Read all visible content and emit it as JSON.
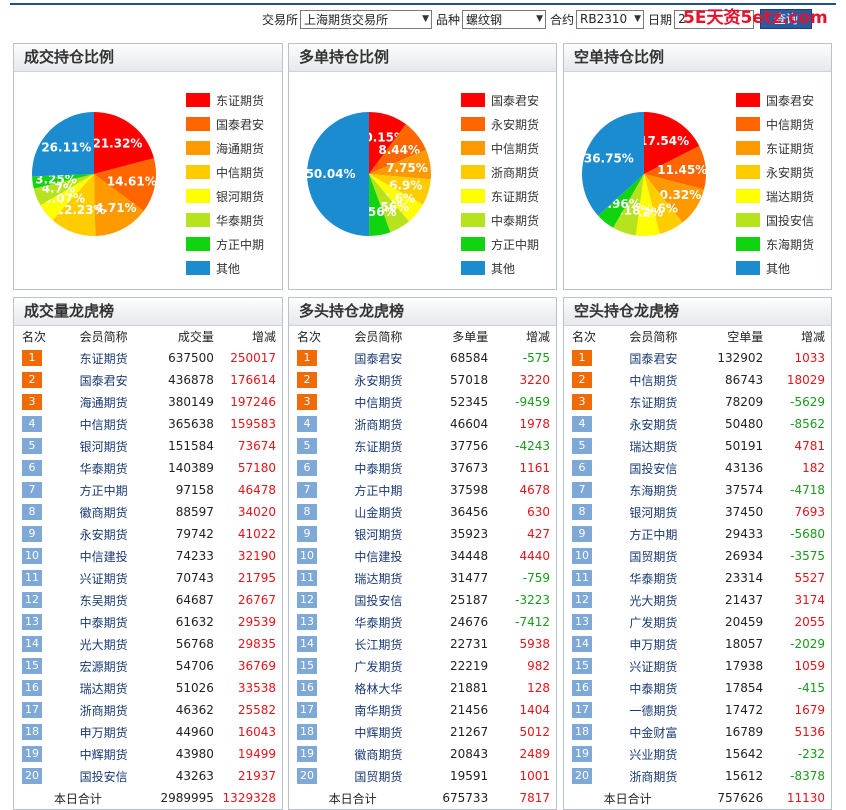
{
  "toolbar": {
    "exchange_label": "交易所",
    "exchange_value": "上海期货交易所",
    "product_label": "品种",
    "product_value": "螺纹钢",
    "contract_label": "合约",
    "contract_value": "RB2310",
    "date_label": "日期",
    "date_value": "2",
    "query_label": "查询"
  },
  "watermark": "5E天资5etz.com",
  "pie_panels": [
    {
      "title": "成交持仓比例",
      "chart_data": {
        "type": "pie",
        "slices": [
          {
            "name": "东证期货",
            "value": 21.32,
            "label": "21.32%",
            "color": "#ff0000"
          },
          {
            "name": "国泰君安",
            "value": 14.61,
            "label": "14.61%",
            "color": "#ff6600"
          },
          {
            "name": "海通期货",
            "value": 14.71,
            "label": "14.71%",
            "color": "#ff9900"
          },
          {
            "name": "中信期货",
            "value": 12.23,
            "label": "12.23%",
            "color": "#ffcc00"
          },
          {
            "name": "银河期货",
            "value": 5.07,
            "label": "5.07%",
            "color": "#ffff00"
          },
          {
            "name": "华泰期货",
            "value": 4.7,
            "label": "4.7%",
            "color": "#b6e21e"
          },
          {
            "name": "方正中期",
            "value": 3.25,
            "label": "3.25%",
            "color": "#10d410"
          },
          {
            "name": "其他",
            "value": 26.11,
            "label": "26.11%",
            "color": "#1a8ccf"
          }
        ]
      }
    },
    {
      "title": "多单持仓比例",
      "chart_data": {
        "type": "pie",
        "slices": [
          {
            "name": "国泰君安",
            "value": 10.15,
            "label": "10.15%",
            "color": "#ff0000"
          },
          {
            "name": "永安期货",
            "value": 8.44,
            "label": "8.44%",
            "color": "#ff6600"
          },
          {
            "name": "中信期货",
            "value": 7.75,
            "label": "7.75%",
            "color": "#ff9900"
          },
          {
            "name": "浙商期货",
            "value": 6.9,
            "label": "6.9%",
            "color": "#ffcc00"
          },
          {
            "name": "东证期货",
            "value": 5.6,
            "label": "5.6%",
            "color": "#ffff00"
          },
          {
            "name": "中泰期货",
            "value": 5.56,
            "label": "5.56%",
            "color": "#b6e21e"
          },
          {
            "name": "方正中期",
            "value": 5.56,
            "label": "5.56%",
            "color": "#10d410"
          },
          {
            "name": "其他",
            "value": 50.04,
            "label": "50.04%",
            "color": "#1a8ccf"
          }
        ]
      }
    },
    {
      "title": "空单持仓比例",
      "chart_data": {
        "type": "pie",
        "slices": [
          {
            "name": "国泰君安",
            "value": 17.54,
            "label": "17.54%",
            "color": "#ff0000"
          },
          {
            "name": "中信期货",
            "value": 11.45,
            "label": "11.45%",
            "color": "#ff6600"
          },
          {
            "name": "东证期货",
            "value": 10.32,
            "label": "10.32%",
            "color": "#ff9900"
          },
          {
            "name": "永安期货",
            "value": 6.6,
            "label": "6.6%",
            "color": "#ffcc00"
          },
          {
            "name": "瑞达期货",
            "value": 6.2,
            "label": "6.2%",
            "color": "#ffff00"
          },
          {
            "name": "国投安信",
            "value": 6.18,
            "label": "6.18%",
            "color": "#b6e21e"
          },
          {
            "name": "东海期货",
            "value": 4.96,
            "label": "4.96%",
            "color": "#10d410"
          },
          {
            "name": "其他",
            "value": 36.75,
            "label": "36.75%",
            "color": "#1a8ccf"
          }
        ]
      }
    }
  ],
  "rank_panels": [
    {
      "title": "成交量龙虎榜",
      "headers": [
        "名次",
        "会员简称",
        "成交量",
        "增减"
      ],
      "rows": [
        [
          "1",
          "东证期货",
          "637500",
          "250017"
        ],
        [
          "2",
          "国泰君安",
          "436878",
          "176614"
        ],
        [
          "3",
          "海通期货",
          "380149",
          "197246"
        ],
        [
          "4",
          "中信期货",
          "365638",
          "159583"
        ],
        [
          "5",
          "银河期货",
          "151584",
          "73674"
        ],
        [
          "6",
          "华泰期货",
          "140389",
          "57180"
        ],
        [
          "7",
          "方正中期",
          "97158",
          "46478"
        ],
        [
          "8",
          "徽商期货",
          "88597",
          "34020"
        ],
        [
          "9",
          "永安期货",
          "79742",
          "41022"
        ],
        [
          "10",
          "中信建投",
          "74233",
          "32190"
        ],
        [
          "11",
          "兴证期货",
          "70743",
          "21795"
        ],
        [
          "12",
          "东吴期货",
          "64687",
          "26767"
        ],
        [
          "13",
          "中泰期货",
          "61632",
          "29539"
        ],
        [
          "14",
          "光大期货",
          "56768",
          "29835"
        ],
        [
          "15",
          "宏源期货",
          "54706",
          "36769"
        ],
        [
          "16",
          "瑞达期货",
          "51026",
          "33538"
        ],
        [
          "17",
          "浙商期货",
          "46362",
          "25582"
        ],
        [
          "18",
          "申万期货",
          "44960",
          "16043"
        ],
        [
          "19",
          "中辉期货",
          "43980",
          "19499"
        ],
        [
          "20",
          "国投安信",
          "43263",
          "21937"
        ]
      ],
      "total_label": "本日合计",
      "total_value": "2989995",
      "total_change": "1329328"
    },
    {
      "title": "多头持仓龙虎榜",
      "headers": [
        "名次",
        "会员简称",
        "多单量",
        "增减"
      ],
      "rows": [
        [
          "1",
          "国泰君安",
          "68584",
          "-575"
        ],
        [
          "2",
          "永安期货",
          "57018",
          "3220"
        ],
        [
          "3",
          "中信期货",
          "52345",
          "-9459"
        ],
        [
          "4",
          "浙商期货",
          "46604",
          "1978"
        ],
        [
          "5",
          "东证期货",
          "37756",
          "-4243"
        ],
        [
          "6",
          "中泰期货",
          "37673",
          "1161"
        ],
        [
          "7",
          "方正中期",
          "37598",
          "4678"
        ],
        [
          "8",
          "山金期货",
          "36456",
          "630"
        ],
        [
          "9",
          "银河期货",
          "35923",
          "427"
        ],
        [
          "10",
          "中信建投",
          "34448",
          "4440"
        ],
        [
          "11",
          "瑞达期货",
          "31477",
          "-759"
        ],
        [
          "12",
          "国投安信",
          "25187",
          "-3223"
        ],
        [
          "13",
          "华泰期货",
          "24676",
          "-7412"
        ],
        [
          "14",
          "长江期货",
          "22731",
          "5938"
        ],
        [
          "15",
          "广发期货",
          "22219",
          "982"
        ],
        [
          "16",
          "格林大华",
          "21881",
          "128"
        ],
        [
          "17",
          "南华期货",
          "21456",
          "1404"
        ],
        [
          "18",
          "中辉期货",
          "21267",
          "5012"
        ],
        [
          "19",
          "徽商期货",
          "20843",
          "2489"
        ],
        [
          "20",
          "国贸期货",
          "19591",
          "1001"
        ]
      ],
      "total_label": "本日合计",
      "total_value": "675733",
      "total_change": "7817"
    },
    {
      "title": "空头持仓龙虎榜",
      "headers": [
        "名次",
        "会员简称",
        "空单量",
        "增减"
      ],
      "rows": [
        [
          "1",
          "国泰君安",
          "132902",
          "1033"
        ],
        [
          "2",
          "中信期货",
          "86743",
          "18029"
        ],
        [
          "3",
          "东证期货",
          "78209",
          "-5629"
        ],
        [
          "4",
          "永安期货",
          "50480",
          "-8562"
        ],
        [
          "5",
          "瑞达期货",
          "50191",
          "4781"
        ],
        [
          "6",
          "国投安信",
          "43136",
          "182"
        ],
        [
          "7",
          "东海期货",
          "37574",
          "-4718"
        ],
        [
          "8",
          "银河期货",
          "37450",
          "7693"
        ],
        [
          "9",
          "方正中期",
          "29433",
          "-5680"
        ],
        [
          "10",
          "国贸期货",
          "26934",
          "-3575"
        ],
        [
          "11",
          "华泰期货",
          "23314",
          "5527"
        ],
        [
          "12",
          "光大期货",
          "21437",
          "3174"
        ],
        [
          "13",
          "广发期货",
          "20459",
          "2055"
        ],
        [
          "14",
          "申万期货",
          "18057",
          "-2029"
        ],
        [
          "15",
          "兴证期货",
          "17938",
          "1059"
        ],
        [
          "16",
          "中泰期货",
          "17854",
          "-415"
        ],
        [
          "17",
          "一德期货",
          "17472",
          "1679"
        ],
        [
          "18",
          "中金财富",
          "16789",
          "5136"
        ],
        [
          "19",
          "兴业期货",
          "15642",
          "-232"
        ],
        [
          "20",
          "浙商期货",
          "15612",
          "-8378"
        ]
      ],
      "total_label": "本日合计",
      "total_value": "757626",
      "total_change": "11130"
    }
  ]
}
